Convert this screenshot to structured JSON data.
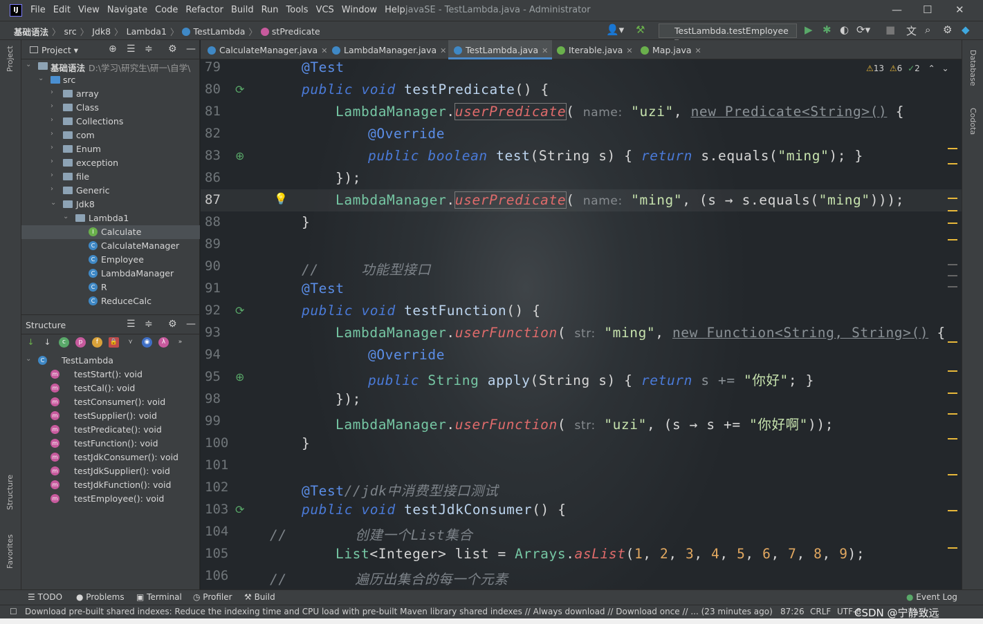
{
  "menu": {
    "items": [
      "File",
      "Edit",
      "View",
      "Navigate",
      "Code",
      "Refactor",
      "Build",
      "Run",
      "Tools",
      "VCS",
      "Window",
      "Help"
    ],
    "window_title": "javaSE - TestLambda.java - Administrator"
  },
  "nav": {
    "crumbs": [
      "基础语法",
      "src",
      "Jdk8",
      "Lambda1",
      "TestLambda",
      "stPredicate"
    ],
    "run_config": "TestLambda.testEmployee"
  },
  "project": {
    "title": "Project",
    "root": "基础语法",
    "root_path": "D:\\学习\\研究生\\研一\\自学\\",
    "items": [
      "src",
      "array",
      "Class",
      "Collections",
      "com",
      "Enum",
      "exception",
      "file",
      "Generic",
      "Jdk8",
      "Lambda1",
      "Calculate",
      "CalculateManager",
      "Employee",
      "LambdaManager",
      "R",
      "ReduceCalc"
    ]
  },
  "structure": {
    "title": "Structure",
    "class": "TestLambda",
    "methods": [
      "testStart(): void",
      "testCal(): void",
      "testConsumer(): void",
      "testSupplier(): void",
      "testPredicate(): void",
      "testFunction(): void",
      "testJdkConsumer(): void",
      "testJdkSupplier(): void",
      "testJdkFunction(): void",
      "testEmployee(): void"
    ]
  },
  "tabs": [
    "CalculateManager.java",
    "LambdaManager.java",
    "TestLambda.java",
    "Iterable.java",
    "Map.java"
  ],
  "editor": {
    "line_numbers": [
      "79",
      "80",
      "81",
      "82",
      "83",
      "86",
      "87",
      "88",
      "89",
      "90",
      "91",
      "92",
      "93",
      "94",
      "95",
      "98",
      "99",
      "100",
      "101",
      "102",
      "103",
      "104",
      "105",
      "106"
    ],
    "inspections": {
      "warnings": "13",
      "weak": "6",
      "ok": "2"
    },
    "code": {
      "l79": "@Test",
      "l80_kw": "public void",
      "l80_fn": "testPredicate",
      "l80_rest": "() {",
      "l81_cls": "LambdaManager",
      "l81_mt": "userPredicate",
      "l81_hint": "name:",
      "l81_str": "\"uzi\"",
      "l81_new": "new Predicate<String>()",
      "l81_end": " {",
      "l82": "@Override",
      "l83_kw": "public boolean",
      "l83_fn": "test",
      "l83_a": "(String s) {",
      "l83_ret": "return",
      "l83_b": "s.equals(",
      "l83_str": "\"ming\"",
      "l83_c": "); }",
      "l86": "});",
      "l87_cls": "LambdaManager",
      "l87_mt": "userPredicate",
      "l87_hint": "name:",
      "l87_str": "\"ming\"",
      "l87_a": ", (s → s.equals(",
      "l87_str2": "\"ming\"",
      "l87_b": ")));",
      "l88": "}",
      "l90_cm": "//     功能型接口",
      "l91": "@Test",
      "l92_kw": "public void",
      "l92_fn": "testFunction",
      "l92_rest": "() {",
      "l93_cls": "LambdaManager",
      "l93_mt": "userFunction",
      "l93_hint": "str:",
      "l93_str": "\"ming\"",
      "l93_new": "new Function<String, String>()",
      "l93_end": " {",
      "l94": "@Override",
      "l95_kw": "public",
      "l95_cls": "String",
      "l95_fn": "apply",
      "l95_a": "(String s) {",
      "l95_ret": "return",
      "l95_b": "s += ",
      "l95_str": "\"你好\"",
      "l95_c": "; }",
      "l98": "});",
      "l99_cls": "LambdaManager",
      "l99_mt": "userFunction",
      "l99_hint": "str:",
      "l99_str": "\"uzi\"",
      "l99_a": ", (s → s += ",
      "l99_str2": "\"你好啊\"",
      "l99_b": "));",
      "l100": "}",
      "l102_an": "@Test",
      "l102_cm": "//jdk中消费型接口测试",
      "l103_kw": "public void",
      "l103_fn": "testJdkConsumer",
      "l103_rest": "() {",
      "l104_cm": "//        创建一个List集合",
      "l105_a": "List",
      "l105_b": "<Integer> list = ",
      "l105_cls": "Arrays",
      "l105_mt": "asList",
      "l105_nums": [
        "1",
        "2",
        "3",
        "4",
        "5",
        "6",
        "7",
        "8",
        "9"
      ],
      "l106_cm": "//        遍历出集合的每一个元素"
    }
  },
  "right_tabs": [
    "Database",
    "Codota"
  ],
  "left_tabs": [
    "Project",
    "Structure",
    "Favorites"
  ],
  "toolwindows": [
    "TODO",
    "Problems",
    "Terminal",
    "Profiler",
    "Build",
    "Event Log"
  ],
  "status": {
    "message": "Download pre-built shared indexes: Reduce the indexing time and CPU load with pre-built Maven library shared indexes // Always download // Download once // ... (23 minutes ago)",
    "pos": "87:26",
    "eol": "CRLF",
    "enc": "UTF-8",
    "watermark": "CSDN @宁静致远"
  }
}
